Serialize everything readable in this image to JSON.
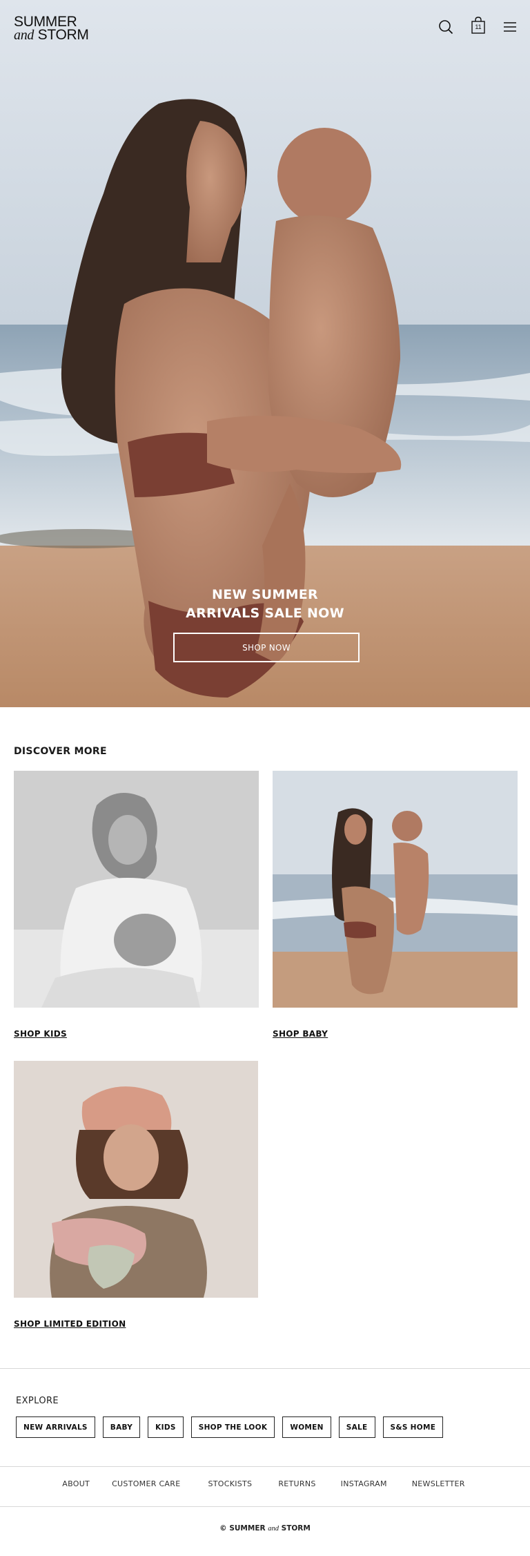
{
  "brand": {
    "line1": "SUMMER",
    "and": "and",
    "line2": "STORM"
  },
  "header": {
    "cart_count": "11",
    "icons": [
      "search-icon",
      "cart-icon",
      "menu-icon"
    ]
  },
  "hero": {
    "title_line1": "NEW SUMMER",
    "title_line2": "ARRIVALS SALE NOW",
    "button_label": "SHOP NOW"
  },
  "discover": {
    "title": "DISCOVER MORE",
    "tiles": [
      {
        "label": "SHOP KIDS"
      },
      {
        "label": "SHOP BABY"
      },
      {
        "label": "SHOP LIMITED EDITION"
      }
    ]
  },
  "explore": {
    "title": "EXPLORE",
    "chips": [
      "NEW ARRIVALS",
      "BABY",
      "KIDS",
      "SHOP THE LOOK",
      "WOMEN",
      "SALE",
      "S&S HOME"
    ]
  },
  "footer": {
    "links": [
      "ABOUT",
      "CUSTOMER CARE",
      "STOCKISTS",
      "RETURNS",
      "INSTAGRAM",
      "NEWSLETTER"
    ],
    "copyright_prefix": "© SUMMER",
    "copyright_and": "and",
    "copyright_suffix": "STORM"
  },
  "colors": {
    "text": "#1a1a1a",
    "background": "#ffffff",
    "rule": "#d8d8d8"
  }
}
